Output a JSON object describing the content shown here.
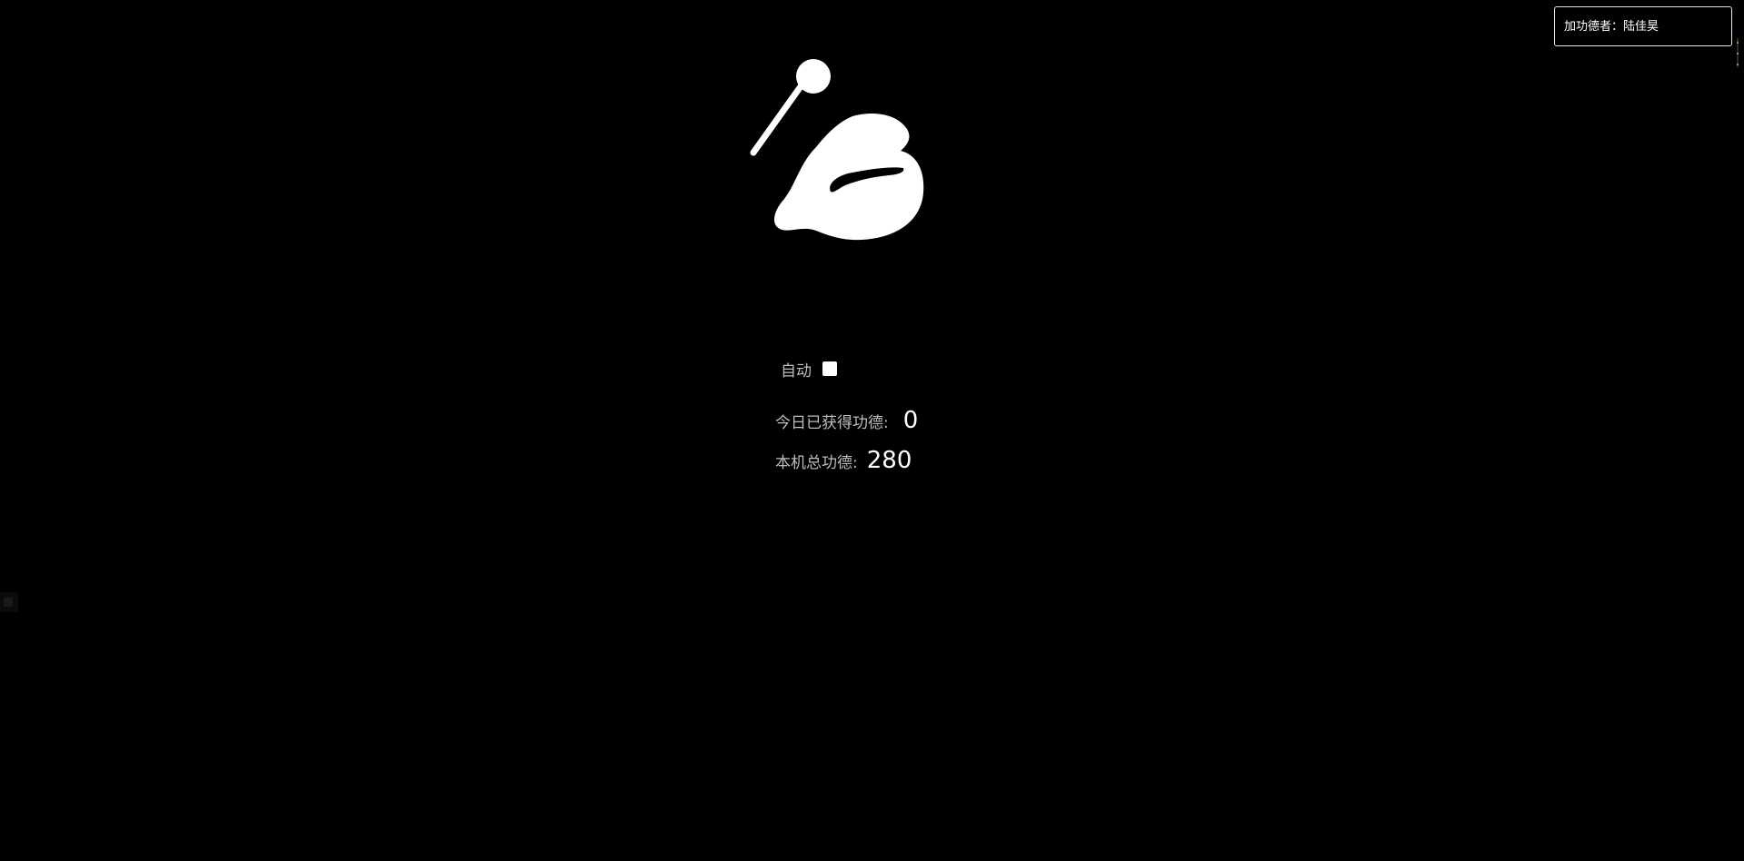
{
  "badge": {
    "label": "加功德者：",
    "name": "陆佳昊"
  },
  "controls": {
    "auto_label": "自动",
    "auto_checked": false
  },
  "stats": {
    "today_label": "今日已获得功德:",
    "today_value": "0",
    "total_label": "本机总功德:",
    "total_value": "280"
  },
  "colors": {
    "background": "#000000",
    "fish": "#ffffff",
    "label_text": "#bdbdbd",
    "value_text": "#ffffff"
  },
  "icons": {
    "fish": "wooden-fish-icon",
    "mallet": "mallet-icon"
  }
}
